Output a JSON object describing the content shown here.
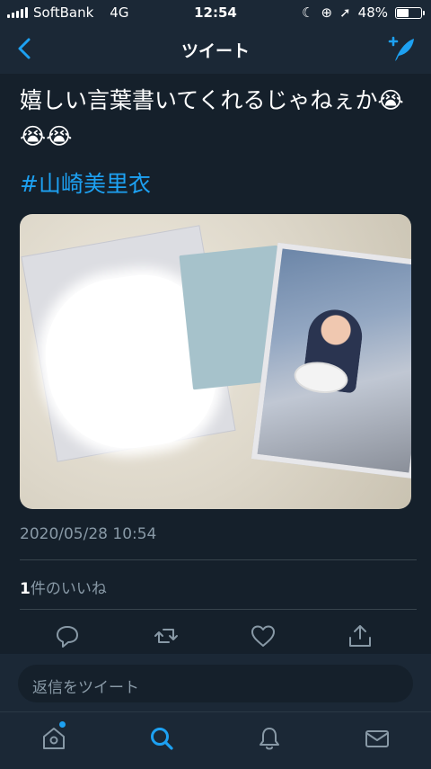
{
  "status": {
    "carrier": "SoftBank",
    "network": "4G",
    "time": "12:54",
    "battery": "48%",
    "battery_level": 0.48
  },
  "nav": {
    "title": "ツイート",
    "back_icon": "chevron-left-icon",
    "compose_icon": "compose-tweet-icon"
  },
  "tweet": {
    "text": "嬉しい言葉書いてくれるじゃねぇか😭😭😭",
    "hashtag": "#山崎美里衣",
    "timestamp": "2020/05/28 10:54",
    "likes_count": "1",
    "likes_label": "件のいいね"
  },
  "actions": [
    "reply-icon",
    "retweet-icon",
    "like-icon",
    "share-icon"
  ],
  "reply": {
    "placeholder": "返信をツイート"
  },
  "tabs": [
    "home-icon",
    "search-icon",
    "notifications-icon",
    "messages-icon"
  ],
  "colors": {
    "background": "#15202b",
    "bar": "#1b2836",
    "accent": "#1da1f2",
    "muted": "#8899a6"
  }
}
